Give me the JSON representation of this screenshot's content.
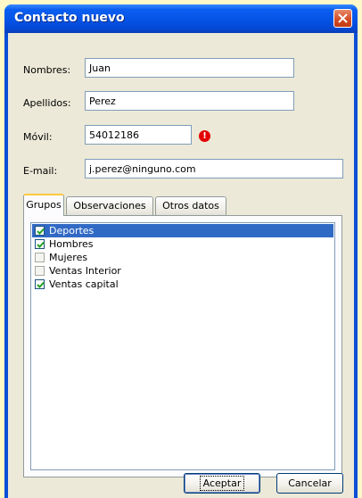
{
  "window": {
    "title": "Contacto nuevo"
  },
  "form": {
    "nombres_label": "Nombres:",
    "nombres_value": "Juan",
    "apellidos_label": "Apellidos:",
    "apellidos_value": "Perez",
    "movil_label": "Móvil:",
    "movil_value": "54012186",
    "movil_warning_icon": "exclamation-icon",
    "email_label": "E-mail:",
    "email_value": "j.perez@ninguno.com"
  },
  "tabs": [
    {
      "label": "Grupos",
      "active": true
    },
    {
      "label": "Observaciones",
      "active": false
    },
    {
      "label": "Otros datos",
      "active": false
    }
  ],
  "groups": [
    {
      "label": "Deportes",
      "checked": true,
      "selected": true
    },
    {
      "label": "Hombres",
      "checked": true,
      "selected": false
    },
    {
      "label": "Mujeres",
      "checked": false,
      "selected": false
    },
    {
      "label": "Ventas Interior",
      "checked": false,
      "selected": false
    },
    {
      "label": "Ventas capital",
      "checked": true,
      "selected": false
    }
  ],
  "buttons": {
    "accept": "Aceptar",
    "cancel": "Cancelar"
  },
  "colors": {
    "titlebar": "#0553e6",
    "selection": "#316ac5",
    "warning": "#e30000"
  }
}
